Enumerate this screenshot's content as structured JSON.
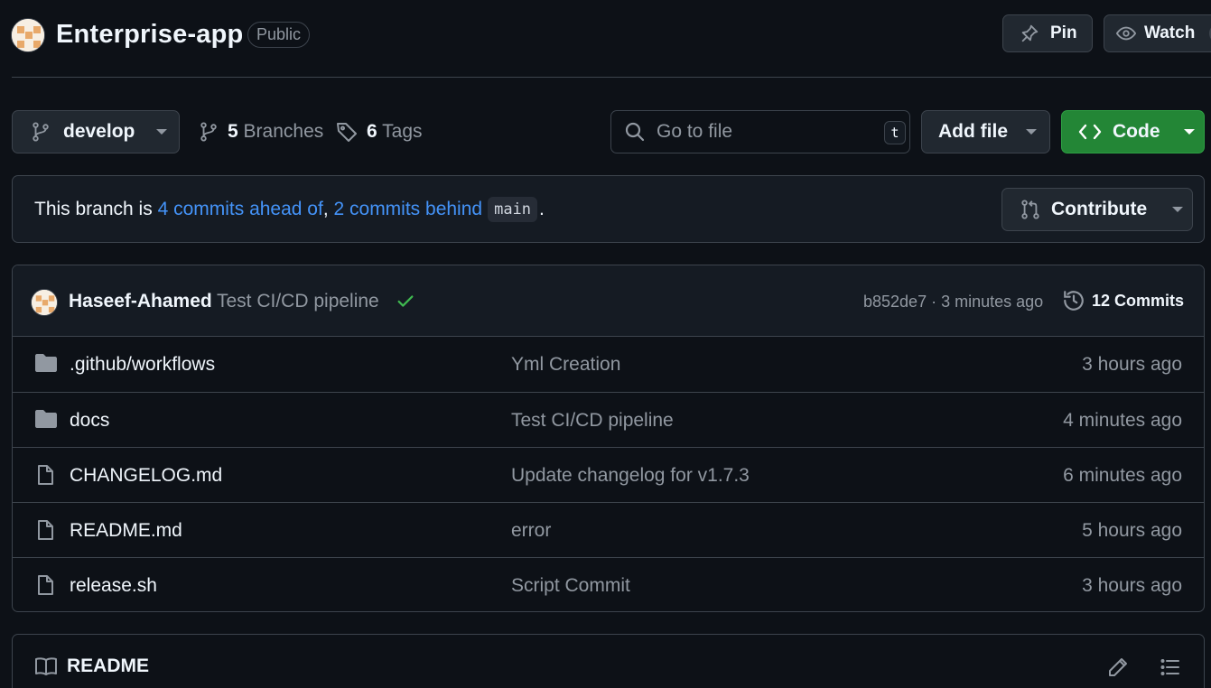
{
  "repo": {
    "name": "Enterprise-app",
    "visibility": "Public"
  },
  "header": {
    "pin_label": "Pin",
    "watch_label": "Watch"
  },
  "toolbar": {
    "branch": "develop",
    "branches_count": "5",
    "branches_label": "Branches",
    "tags_count": "6",
    "tags_label": "Tags",
    "goto_placeholder": "Go to file",
    "goto_shortcut": "t",
    "add_file_label": "Add file",
    "code_label": "Code"
  },
  "branch_status": {
    "prefix": "This branch is ",
    "ahead": "4 commits ahead of",
    "separator": ", ",
    "behind": "2 commits behind",
    "base_branch": "main",
    "suffix": ".",
    "contribute_label": "Contribute"
  },
  "latest_commit": {
    "author": "Haseef-Ahamed",
    "message": "Test CI/CD pipeline",
    "status": "success",
    "meta": "b852de7 · 3 minutes ago",
    "commits_label": "12 Commits"
  },
  "files": [
    {
      "type": "folder",
      "name": ".github/workflows",
      "commit": "Yml Creation",
      "time": "3 hours ago"
    },
    {
      "type": "folder",
      "name": "docs",
      "commit": "Test CI/CD pipeline",
      "time": "4 minutes ago"
    },
    {
      "type": "file",
      "name": "CHANGELOG.md",
      "commit": "Update changelog for v1.7.3",
      "time": "6 minutes ago"
    },
    {
      "type": "file",
      "name": "README.md",
      "commit": "error",
      "time": "5 hours ago"
    },
    {
      "type": "file",
      "name": "release.sh",
      "commit": "Script Commit",
      "time": "3 hours ago"
    }
  ],
  "readme": {
    "label": "README"
  },
  "colors": {
    "background": "#0d1117",
    "accent_link": "#4493f8",
    "primary_button": "#238636",
    "success": "#3fb950"
  },
  "icons": {
    "pin": "pin-icon",
    "watch": "eye-icon",
    "branch": "git-branch-icon",
    "tag": "tag-icon",
    "search": "search-icon",
    "code": "code-icon",
    "contribute": "git-pull-request-icon",
    "history": "history-icon",
    "folder": "folder-icon",
    "file": "file-icon",
    "book": "book-icon",
    "edit": "pencil-icon",
    "toc": "list-icon"
  }
}
